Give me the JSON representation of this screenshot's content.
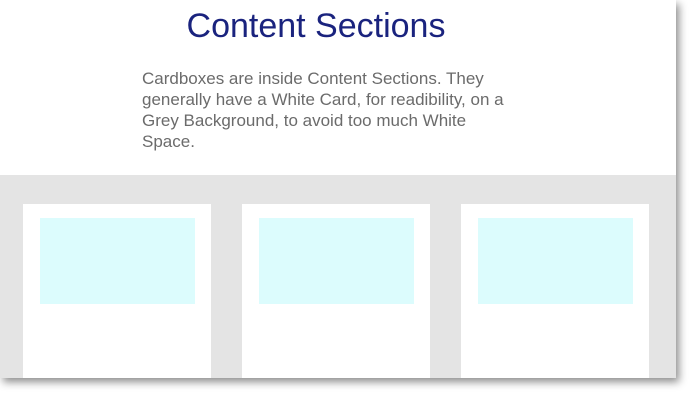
{
  "section": {
    "title": "Content Sections",
    "description": "Cardboxes are inside Content Sections. They generally have a White Card, for readibility, on a Grey Background, to avoid too much White Space."
  },
  "colors": {
    "title": "#1a237e",
    "description_text": "#6b6b6b",
    "grey_background": "#e4e4e4",
    "card": "#ffffff",
    "card_image": "#dcfcfd"
  },
  "cards": [
    {
      "id": "card-1"
    },
    {
      "id": "card-2"
    },
    {
      "id": "card-3"
    }
  ]
}
